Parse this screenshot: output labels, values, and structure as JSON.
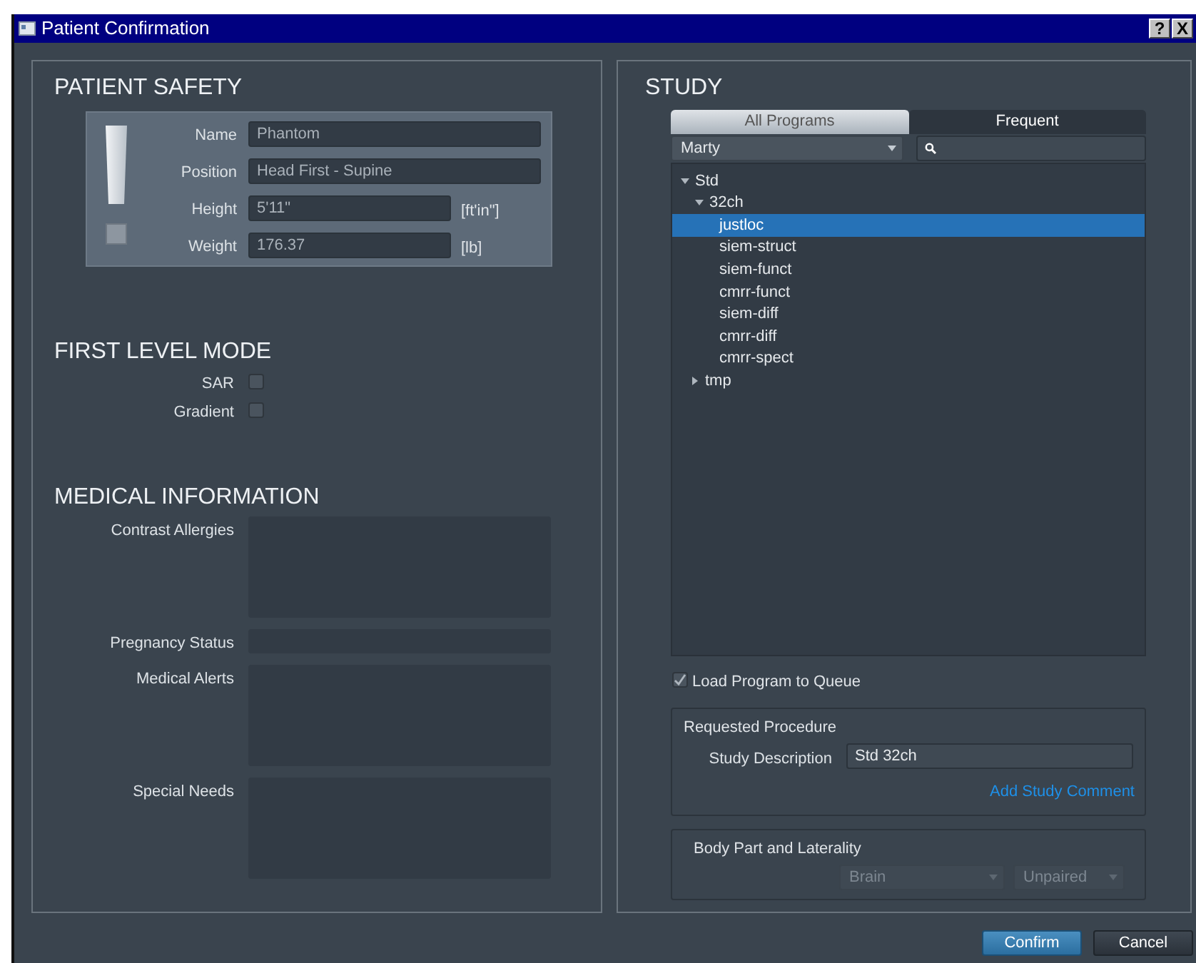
{
  "window": {
    "title": "Patient Confirmation",
    "controls": [
      "?",
      "X"
    ]
  },
  "patient_safety": {
    "title": "PATIENT SAFETY",
    "fields": [
      {
        "label": "Name",
        "value": "Phantom",
        "kind": "wide"
      },
      {
        "label": "Position",
        "value": "Head First - Supine",
        "kind": "wide"
      },
      {
        "label": "Height",
        "value": "5'11\"",
        "unit": "[ft'in\"]",
        "kind": "narrow"
      },
      {
        "label": "Weight",
        "value": "176.37",
        "unit": "[lb]",
        "kind": "narrow"
      }
    ]
  },
  "first_level_mode": {
    "title": "FIRST LEVEL MODE",
    "options": [
      {
        "label": "SAR",
        "checked": false
      },
      {
        "label": "Gradient",
        "checked": false
      }
    ]
  },
  "medical_information": {
    "title": "MEDICAL INFORMATION",
    "fields": [
      {
        "label": "Contrast Allergies",
        "kind": "multiline"
      },
      {
        "label": "Pregnancy Status",
        "kind": "single"
      },
      {
        "label": "Medical Alerts",
        "kind": "multiline"
      },
      {
        "label": "Special Needs",
        "kind": "multiline"
      }
    ]
  },
  "study": {
    "title": "STUDY",
    "tabs": [
      {
        "label": "All Programs",
        "selected": true
      },
      {
        "label": "Frequent",
        "selected": false
      }
    ],
    "program_filter": {
      "value": "Marty"
    },
    "tree": [
      {
        "label": "Std",
        "expanded": true,
        "selected": false,
        "children": [
          {
            "label": "32ch",
            "expanded": true,
            "selected": false,
            "children": [
              {
                "label": "justloc",
                "selected": true
              },
              {
                "label": "siem-struct",
                "selected": false
              },
              {
                "label": "siem-funct",
                "selected": false
              },
              {
                "label": "cmrr-funct",
                "selected": false
              },
              {
                "label": "siem-diff",
                "selected": false
              },
              {
                "label": "cmrr-diff",
                "selected": false
              },
              {
                "label": "cmrr-spect",
                "selected": false
              }
            ]
          },
          {
            "label": "tmp",
            "expanded": false,
            "selected": false
          }
        ]
      }
    ],
    "load_to_queue": {
      "label": "Load Program to Queue",
      "checked": true
    },
    "requested_procedure": {
      "title": "Requested Procedure",
      "study_description": {
        "label": "Study Description",
        "value": "Std 32ch"
      },
      "link": "Add Study Comment"
    },
    "body_part_laterality": {
      "title": "Body Part and Laterality",
      "body_part": {
        "value": "Brain"
      },
      "laterality": {
        "value": "Unpaired"
      }
    }
  },
  "buttons": [
    {
      "label": "Confirm",
      "kind": "primary"
    },
    {
      "label": "Cancel",
      "kind": "secondary"
    }
  ]
}
